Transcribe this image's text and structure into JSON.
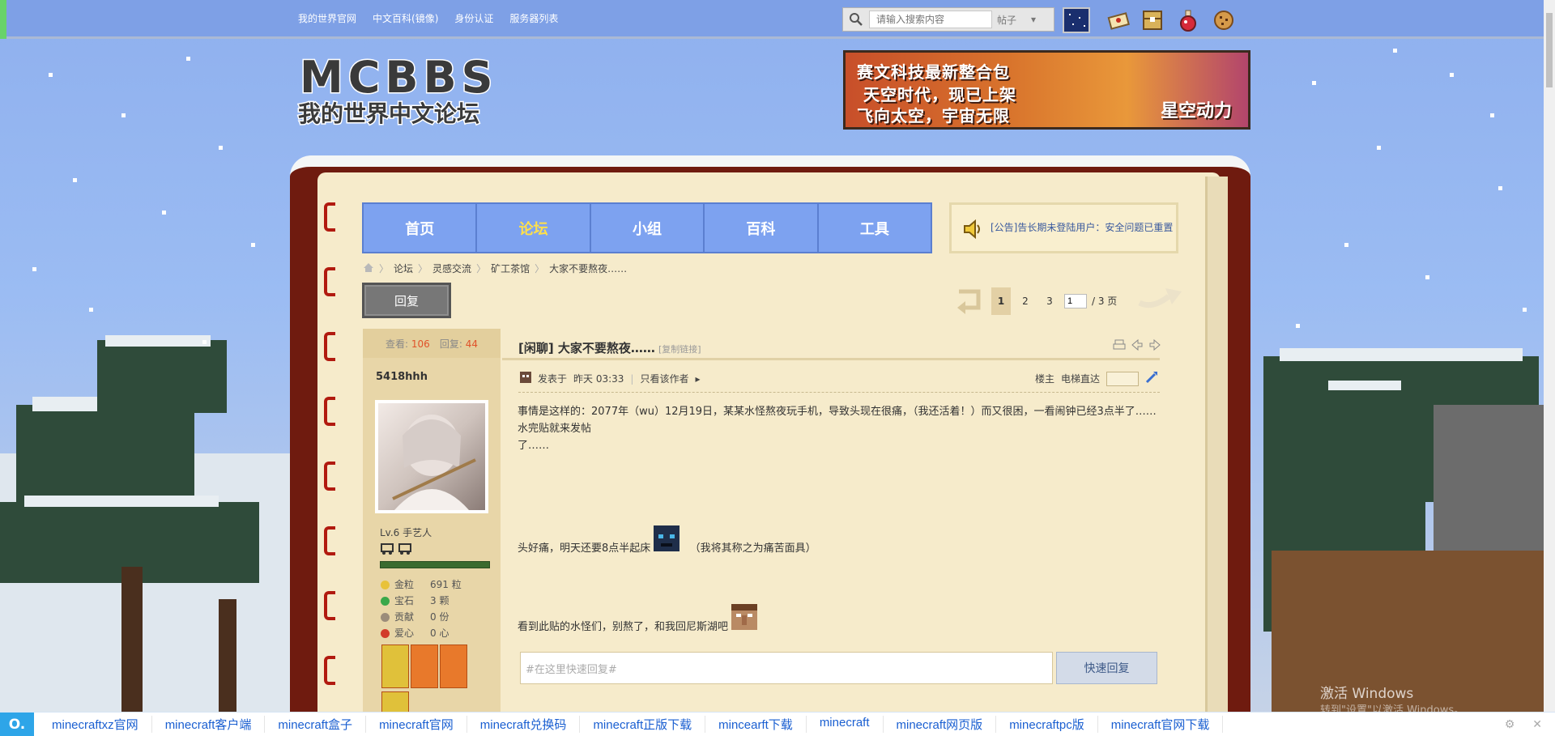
{
  "topbar": {
    "links": [
      "我的世界官网",
      "中文百科(镜像)",
      "身份认证",
      "服务器列表"
    ],
    "search": {
      "placeholder": "请输入搜索内容",
      "type": "帖子"
    },
    "icons": [
      "night-mode-icon",
      "letter-icon",
      "chest-icon",
      "potion-icon",
      "cookie-icon"
    ]
  },
  "header": {
    "logo_title": "MCBBS",
    "logo_subtitle": "我的世界中文论坛",
    "banner": {
      "line1": "赛文科技最新整合包",
      "line2": "天空时代，现已上架",
      "line3": "飞向太空，宇宙无限",
      "brand": "星空动力"
    }
  },
  "nav": {
    "tabs": [
      "首页",
      "论坛",
      "小组",
      "百科",
      "工具"
    ],
    "active": "论坛"
  },
  "notice": {
    "text": "[公告]告长期未登陆用户：安全问题已重置"
  },
  "breadcrumb": [
    "论坛",
    "灵感交流",
    "矿工茶馆",
    "大家不要熬夜……"
  ],
  "actions": {
    "reply_label": "回复",
    "pages": [
      "1",
      "2",
      "3"
    ],
    "current_page": "1",
    "page_input": "1",
    "page_total": "/ 3 页"
  },
  "author": {
    "views_label": "查看:",
    "views": "106",
    "replies_label": "回复:",
    "replies": "44",
    "name": "5418hhh",
    "level": "Lv.6 手艺人",
    "stats": [
      {
        "label": "金粒",
        "value": "691 粒",
        "color": "#e8c23a"
      },
      {
        "label": "宝石",
        "value": "3 颗",
        "color": "#3aa84a"
      },
      {
        "label": "贡献",
        "value": "0 份",
        "color": "#9b8c7a"
      },
      {
        "label": "爱心",
        "value": "0 心",
        "color": "#d23b2a"
      }
    ]
  },
  "post": {
    "title": "[闲聊] 大家不要熬夜……",
    "copy_link": "[复制链接]",
    "posted_prefix": "发表于",
    "posted_time": "昨天 03:33",
    "only_author": "只看该作者",
    "floor": "楼主",
    "elevator": "电梯直达",
    "paragraph1": "事情是这样的：2077年（wu）12月19日，某某水怪熬夜玩手机，导致头现在很痛，（我还活着！）而又很困，一看闹钟已经3点半了……水完贴就来发帖",
    "paragraph1b": "了……",
    "paragraph2": "头好痛，明天还要8点半起床",
    "paragraph2b": "（我将其称之为痛苦面具）",
    "paragraph3": "看到此贴的水怪们，别熬了，和我回尼斯湖吧",
    "quick_reply_placeholder": "#在这里快速回复#",
    "quick_reply_button": "快速回复"
  },
  "watermark": {
    "line1": "激活 Windows",
    "line2": "转到\"设置\"以激活 Windows。"
  },
  "linkbar": {
    "items": [
      "minecraftxz官网",
      "minecraft客户端",
      "minecraft盒子",
      "minecraft官网",
      "minecraft兑换码",
      "minecraft正版下载",
      "mincearft下载",
      "minecraft",
      "minecraft网页版",
      "minecraftpc版",
      "minecraft官网下载"
    ]
  }
}
